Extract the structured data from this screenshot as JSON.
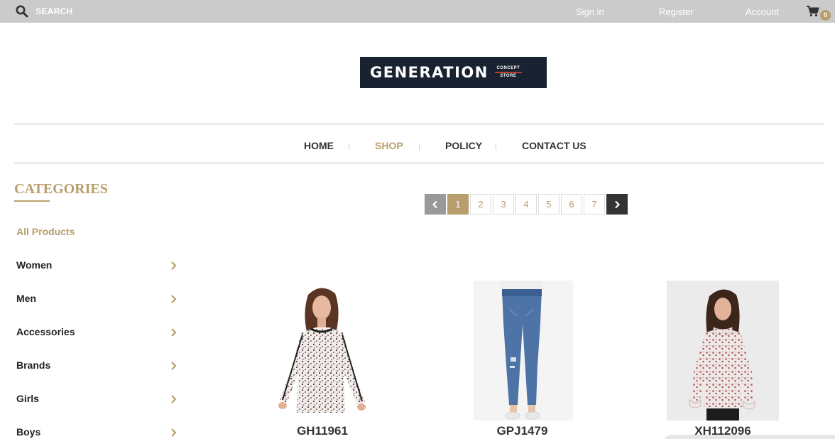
{
  "topbar": {
    "search_label": "SEARCH",
    "sign_in": "Sign in",
    "register": "Register",
    "account": "Account",
    "cart_count": "0"
  },
  "logo": {
    "main": "GENERATION",
    "sub_top": "CONCEPT",
    "sub_bottom": "STORE"
  },
  "nav": {
    "items": [
      {
        "label": "HOME"
      },
      {
        "label": "SHOP"
      },
      {
        "label": "POLICY"
      },
      {
        "label": "CONTACT US"
      }
    ],
    "active": "SHOP"
  },
  "sidebar": {
    "title": "CATEGORIES",
    "items": [
      {
        "label": "All Products"
      },
      {
        "label": "Women"
      },
      {
        "label": "Men"
      },
      {
        "label": "Accessories"
      },
      {
        "label": "Brands"
      },
      {
        "label": "Girls"
      },
      {
        "label": "Boys"
      }
    ]
  },
  "pagination": {
    "pages": [
      "1",
      "2",
      "3",
      "4",
      "5",
      "6",
      "7"
    ],
    "current": "1"
  },
  "products": [
    {
      "code": "GH11961"
    },
    {
      "code": "GPJ1479"
    },
    {
      "code": "XH112096"
    }
  ],
  "colors": {
    "accent": "#b89e6c",
    "topbar": "#cbcbcb",
    "logo_bg": "#182230",
    "text": "#333333"
  },
  "icons": {
    "search": "search-icon",
    "cart": "cart-icon",
    "chevron": "chevron-right-icon"
  }
}
